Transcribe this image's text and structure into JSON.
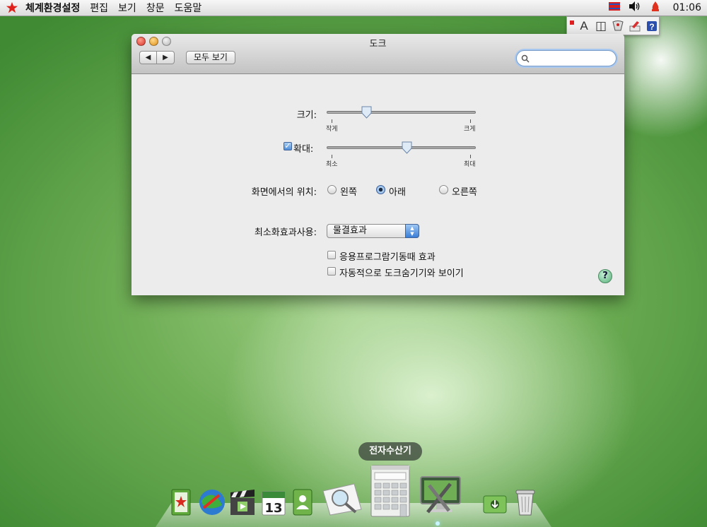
{
  "menubar": {
    "items": [
      "체계환경설정",
      "편집",
      "보기",
      "창문",
      "도움말"
    ],
    "clock": "01:06",
    "icons": [
      "red-star-icon",
      "flag-icon",
      "volume-icon",
      "input-source-icon"
    ]
  },
  "input_menu": {
    "items": [
      {
        "icon": "text-a-icon",
        "glyph": "A"
      },
      {
        "icon": "split-view-icon",
        "glyph": "◫"
      },
      {
        "icon": "keyboard-pen-icon",
        "glyph": "✎"
      },
      {
        "icon": "character-palette-icon",
        "glyph": "✍"
      },
      {
        "icon": "help-book-icon",
        "glyph": "?"
      }
    ]
  },
  "window": {
    "title": "도크",
    "show_all": "모두 보기",
    "search": {
      "value": "",
      "placeholder": ""
    },
    "size": {
      "label": "크기:",
      "min_label": "작게",
      "max_label": "크게",
      "value": 0.27
    },
    "magnification": {
      "label": "확대:",
      "checked": true,
      "min_label": "최소",
      "max_label": "최대",
      "value": 0.54
    },
    "position": {
      "label": "화면에서의 위치:",
      "options": [
        "왼쪽",
        "아래",
        "오른쪽"
      ],
      "selected": "아래"
    },
    "minimize_effect": {
      "label": "최소화효과사용:",
      "value": "물결효과"
    },
    "checkboxes": [
      {
        "label": "응용프로그람기동때 효과",
        "checked": false
      },
      {
        "label": "자동적으로 도크숨기기와 보이기",
        "checked": false
      }
    ],
    "help": "?"
  },
  "dock": {
    "tooltip": "전자수산기",
    "calendar_day": "13",
    "items": [
      "address-book-icon",
      "globe-browser-icon",
      "movie-clapper-icon",
      "calendar-icon",
      "contacts-icon",
      "photo-preview-icon",
      "calculator-icon",
      "system-tools-icon",
      "downloads-icon",
      "trash-icon"
    ]
  }
}
